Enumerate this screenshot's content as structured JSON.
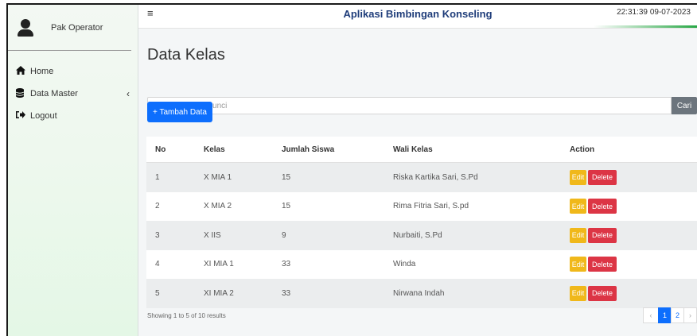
{
  "user": {
    "name": "Pak Operator"
  },
  "sidebar": {
    "items": [
      {
        "label": "Home",
        "icon": "home-icon"
      },
      {
        "label": "Data Master",
        "icon": "database-icon"
      },
      {
        "label": "Logout",
        "icon": "logout-icon"
      }
    ]
  },
  "header": {
    "title": "Aplikasi Bimbingan Konseling",
    "time": "22:31:39",
    "date": "09-07-2023"
  },
  "page": {
    "title": "Data Kelas",
    "search_placeholder": "Masukkan kata kunci",
    "search_label": "Cari",
    "add_label": "+ Tambah Data"
  },
  "table": {
    "headers": [
      "No",
      "Kelas",
      "Jumlah Siswa",
      "Wali Kelas",
      "Action"
    ],
    "rows": [
      [
        "1",
        "X MIA 1",
        "15",
        "Riska Kartika Sari, S.Pd"
      ],
      [
        "2",
        "X MIA 2",
        "15",
        "Rima Fitria Sari, S.pd"
      ],
      [
        "3",
        "X IIS",
        "9",
        "Nurbaiti, S.Pd"
      ],
      [
        "4",
        "XI MIA 1",
        "33",
        "Winda"
      ],
      [
        "5",
        "XI MIA 2",
        "33",
        "Nirwana Indah"
      ]
    ],
    "edit_label": "Edit",
    "delete_label": "Delete"
  },
  "footer": {
    "showing": "Showing 1 to 5 of 10 results",
    "pages": [
      "1",
      "2"
    ],
    "prev": "‹",
    "next": "›"
  },
  "colors": {
    "primary": "#0d6efd",
    "warning": "#f0b81a",
    "danger": "#dc3545",
    "header_title": "#1f3d7a"
  }
}
